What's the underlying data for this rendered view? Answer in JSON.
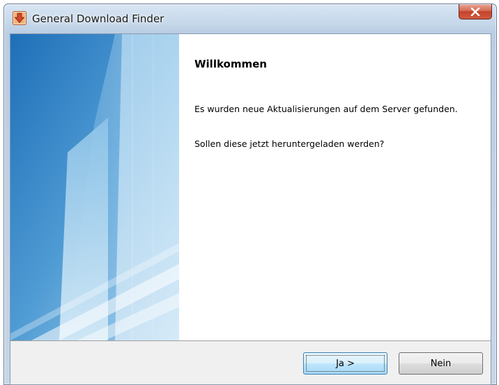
{
  "window": {
    "title": "General Download Finder",
    "close_icon": "close-icon",
    "app_icon": "download-arrow-icon"
  },
  "banner": {
    "image": "blue-building-banner"
  },
  "content": {
    "heading": "Willkommen",
    "paragraph1": "Es wurden neue Aktualisierungen auf dem Server gefunden.",
    "paragraph2": "Sollen diese jetzt heruntergeladen werden?"
  },
  "buttons": {
    "yes_label": "Ja >",
    "no_label": "Nein"
  },
  "colors": {
    "close_button": "#c4432a",
    "banner_blue": "#2f7fc1",
    "footer_bg": "#f0f0f0"
  }
}
